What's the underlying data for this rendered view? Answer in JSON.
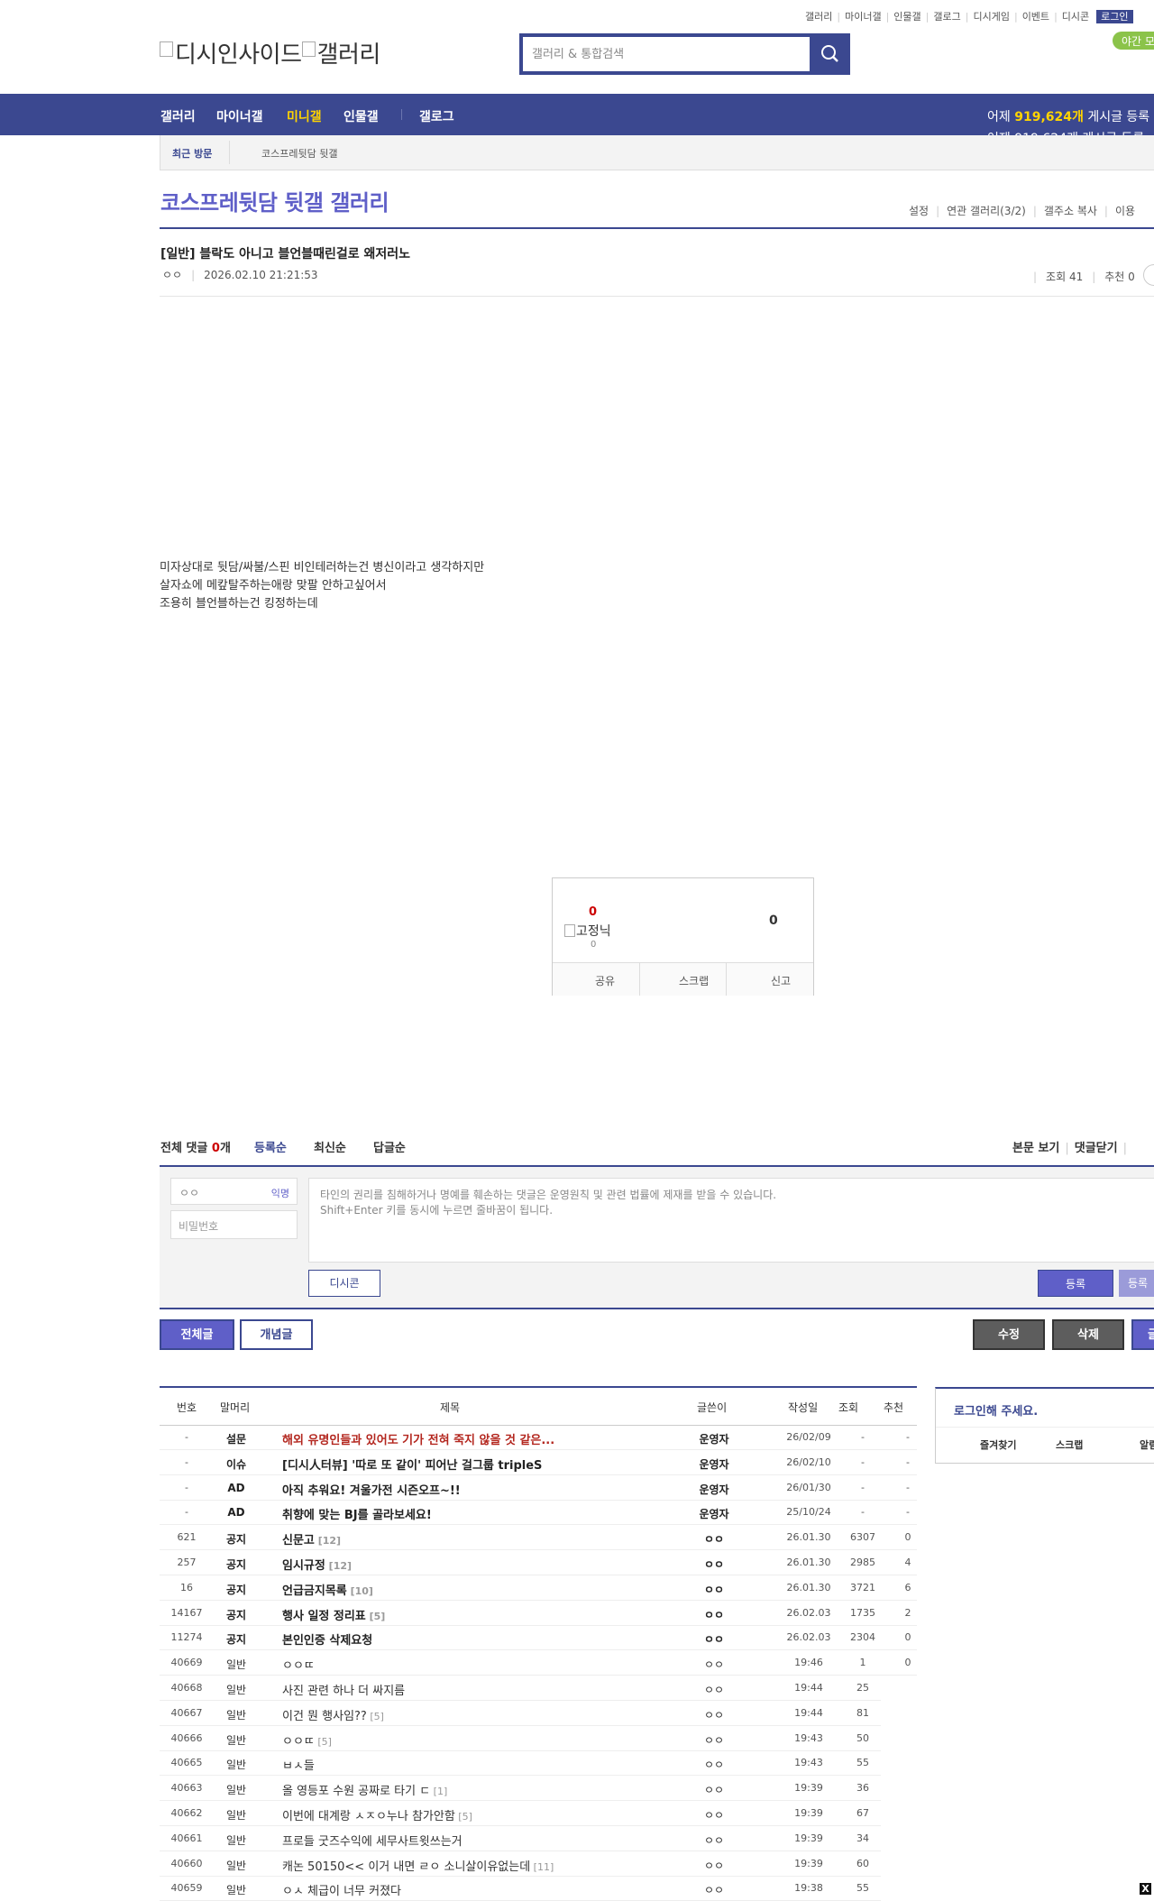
{
  "util_links": [
    "갤러리",
    "마이너갤",
    "인물갤",
    "갤로그",
    "디시게임",
    "이벤트",
    "디시콘"
  ],
  "login_label": "로그인",
  "night_label": "야간 모",
  "logo_alt_a": "디시인사이드",
  "logo_alt_b": "갤러리",
  "search_placeholder": "갤러리 & 통합검색",
  "nav": {
    "items": [
      "갤러리",
      "마이너갤",
      "미니갤",
      "인물갤",
      "갤로그"
    ],
    "active": "미니갤",
    "stat_prefix": "어제 ",
    "stat_count": "919,624개",
    "stat_suffix": " 게시글 등록",
    "stat2": "어제 919,624개 게시글 등록"
  },
  "visit": {
    "label": "최근 방문",
    "item": "코스프레뒷담 뒷갤"
  },
  "gallery_title": "코스프레뒷담 뒷갤 갤러리",
  "gallery_tools": [
    "설정",
    "연관 갤러리(3/2)",
    "갤주소 복사",
    "이용"
  ],
  "post": {
    "title": "[일반] 블락도 아니고 블언블때린걸로 왜저러노",
    "author": "ㅇㅇ",
    "date": "2026.02.10 21:21:53",
    "views": "조회 41",
    "recommend": "추천 0",
    "body": [
      "미자상대로 뒷담/싸불/스핀 비인테러하는건 병신이라고 생각하지만",
      "살자쇼에 메캎탈주하는애랑 맞팔 안하고싶어서",
      "조용히 블언블하는건 킹정하는데"
    ]
  },
  "reco": {
    "up": "0",
    "fixed_label": "고정닉",
    "fixed_count": "0",
    "down": "0",
    "bar": [
      "공유",
      "스크랩",
      "신고"
    ]
  },
  "comments": {
    "total_label": "전체 댓글 ",
    "total_count": "0",
    "total_unit": "개",
    "sorts": [
      "등록순",
      "최신순",
      "답글순"
    ],
    "right": [
      "본문 보기",
      "댓글닫기"
    ],
    "name": "ㅇㅇ",
    "anon": "익명",
    "pw": "비밀번호",
    "placeholder1": "타인의 권리를 침해하거나 명예를 훼손하는 댓글은 운영원칙 및 관련 법률에 제재를 받을 수 있습니다.",
    "placeholder2": "Shift+Enter 키를 동시에 누르면 줄바꿈이 됩니다.",
    "dccon": "디시콘",
    "submit": "등록",
    "submit2": "등록"
  },
  "list_buttons": {
    "all": "전체글",
    "concept": "개념글",
    "edit": "수정",
    "delete": "삭제",
    "write": "글"
  },
  "table": {
    "headers": [
      "번호",
      "말머리",
      "제목",
      "글쓴이",
      "작성일",
      "조회",
      "추천"
    ],
    "rows": [
      {
        "num": "-",
        "head": "설문",
        "title": "해외 유명인들과 있어도 기가 전혀 죽지 않을 것 같은...",
        "writer": "운영자",
        "date": "26/02/09",
        "views": "-",
        "rec": "-",
        "style": "red"
      },
      {
        "num": "-",
        "head": "이슈",
        "title": "[디시人터뷰] '따로 또 같이' 피어난 걸그룹 tripleS",
        "writer": "운영자",
        "date": "26/02/10",
        "views": "-",
        "rec": "-",
        "style": "bold"
      },
      {
        "num": "-",
        "head": "AD",
        "title": "아직 추워요! 겨울가전 시즌오프~!!",
        "writer": "운영자",
        "date": "26/01/30",
        "views": "-",
        "rec": "-",
        "style": "bold"
      },
      {
        "num": "-",
        "head": "AD",
        "title": "취향에 맞는 BJ를 골라보세요!",
        "writer": "운영자",
        "date": "25/10/24",
        "views": "-",
        "rec": "-",
        "style": "bold"
      },
      {
        "num": "621",
        "head": "공지",
        "title": "신문고",
        "rc": "[12]",
        "writer": "ㅇㅇ",
        "date": "26.01.30",
        "views": "6307",
        "rec": "0",
        "style": "bold"
      },
      {
        "num": "257",
        "head": "공지",
        "title": "임시규정",
        "rc": "[12]",
        "writer": "ㅇㅇ",
        "date": "26.01.30",
        "views": "2985",
        "rec": "4",
        "style": "bold"
      },
      {
        "num": "16",
        "head": "공지",
        "title": "언급금지목록",
        "rc": "[10]",
        "writer": "ㅇㅇ",
        "date": "26.01.30",
        "views": "3721",
        "rec": "6",
        "style": "bold"
      },
      {
        "num": "14167",
        "head": "공지",
        "title": "행사 일정 정리표",
        "rc": "[5]",
        "writer": "ㅇㅇ",
        "date": "26.02.03",
        "views": "1735",
        "rec": "2",
        "style": "bold"
      },
      {
        "num": "11274",
        "head": "공지",
        "title": "본인인증 삭제요청",
        "writer": "ㅇㅇ",
        "date": "26.02.03",
        "views": "2304",
        "rec": "0",
        "style": "bold"
      },
      {
        "num": "40669",
        "head": "일반",
        "title": "ㅇㅇㄸ",
        "writer": "ㅇㅇ",
        "date": "19:46",
        "views": "1",
        "rec": "0",
        "style": ""
      },
      {
        "num": "40668",
        "head": "일반",
        "title": "사진 관련 하나 더 싸지름",
        "writer": "ㅇㅇ",
        "date": "19:44",
        "views": "25",
        "rec": "",
        "style": ""
      },
      {
        "num": "40667",
        "head": "일반",
        "title": "이건 뭔 행사임??",
        "rc": "[5]",
        "writer": "ㅇㅇ",
        "date": "19:44",
        "views": "81",
        "rec": "",
        "style": ""
      },
      {
        "num": "40666",
        "head": "일반",
        "title": "ㅇㅇㄸ",
        "rc": "[5]",
        "writer": "ㅇㅇ",
        "date": "19:43",
        "views": "50",
        "rec": "",
        "style": ""
      },
      {
        "num": "40665",
        "head": "일반",
        "title": "ㅂㅅ들",
        "writer": "ㅇㅇ",
        "date": "19:43",
        "views": "55",
        "rec": "",
        "style": ""
      },
      {
        "num": "40663",
        "head": "일반",
        "title": "올 영등포 수원 공짜로 타기 ㄷ",
        "rc": "[1]",
        "writer": "ㅇㅇ",
        "date": "19:39",
        "views": "36",
        "rec": "",
        "style": ""
      },
      {
        "num": "40662",
        "head": "일반",
        "title": "이번에 대계랑 ㅅㅈㅇ누나 참가안함",
        "rc": "[5]",
        "writer": "ㅇㅇ",
        "date": "19:39",
        "views": "67",
        "rec": "",
        "style": ""
      },
      {
        "num": "40661",
        "head": "일반",
        "title": "프로들 굿즈수익에 세무사트윗쓰는거",
        "writer": "ㅇㅇ",
        "date": "19:39",
        "views": "34",
        "rec": "",
        "style": ""
      },
      {
        "num": "40660",
        "head": "일반",
        "title": "캐논 50150<< 이거 내면 ㄹㅇ 소니살이유없는데",
        "rc": "[11]",
        "writer": "ㅇㅇ",
        "date": "19:39",
        "views": "60",
        "rec": "",
        "style": ""
      },
      {
        "num": "40659",
        "head": "일반",
        "title": "ㅇㅅ 체급이 너무 커졌다",
        "writer": "ㅇㅇ",
        "date": "19:38",
        "views": "55",
        "rec": "",
        "style": ""
      }
    ]
  },
  "login_box": {
    "title": "로그인해 주세요.",
    "links": [
      "즐겨찾기",
      "스크랩",
      "알림"
    ]
  },
  "close_x": "X"
}
